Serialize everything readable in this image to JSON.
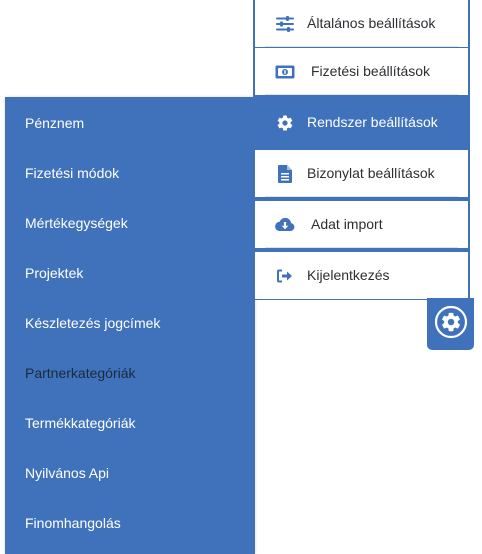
{
  "dropdown": {
    "items": [
      {
        "label": "Általános beállítások",
        "icon": "sliders-icon"
      },
      {
        "label": "Fizetési beállítások",
        "icon": "money-bill-icon"
      },
      {
        "label": "Rendszer beállítások",
        "icon": "gear-icon",
        "active": true
      },
      {
        "label": "Bizonylat beállítások",
        "icon": "document-icon"
      },
      {
        "label": "Adat import",
        "icon": "cloud-download-icon"
      },
      {
        "label": "Kijelentkezés",
        "icon": "sign-out-icon"
      }
    ]
  },
  "submenu": {
    "items": [
      {
        "label": "Pénznem"
      },
      {
        "label": "Fizetési módok"
      },
      {
        "label": "Mértékegységek"
      },
      {
        "label": "Projektek"
      },
      {
        "label": "Készletezés jogcímek"
      },
      {
        "label": "Partnerkategóriák"
      },
      {
        "label": "Termékkategóriák"
      },
      {
        "label": "Nyilvános Api"
      },
      {
        "label": "Finomhangolás"
      }
    ]
  },
  "colors": {
    "accent": "#4072bb",
    "icon": "#4072bb",
    "text_dark": "#2c2f33"
  },
  "settings_toggle": {
    "icon": "gear-icon"
  }
}
